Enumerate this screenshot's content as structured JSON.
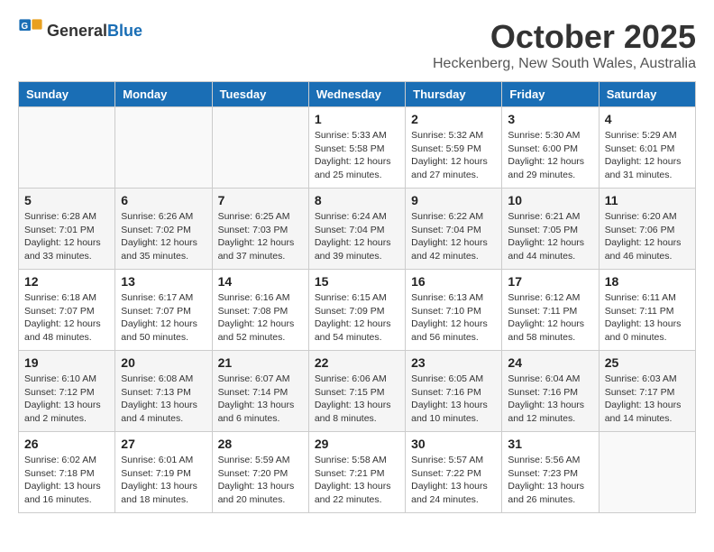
{
  "header": {
    "logo_general": "General",
    "logo_blue": "Blue",
    "title": "October 2025",
    "subtitle": "Heckenberg, New South Wales, Australia"
  },
  "weekdays": [
    "Sunday",
    "Monday",
    "Tuesday",
    "Wednesday",
    "Thursday",
    "Friday",
    "Saturday"
  ],
  "weeks": [
    [
      {
        "day": "",
        "sunrise": "",
        "sunset": "",
        "daylight": ""
      },
      {
        "day": "",
        "sunrise": "",
        "sunset": "",
        "daylight": ""
      },
      {
        "day": "",
        "sunrise": "",
        "sunset": "",
        "daylight": ""
      },
      {
        "day": "1",
        "sunrise": "Sunrise: 5:33 AM",
        "sunset": "Sunset: 5:58 PM",
        "daylight": "Daylight: 12 hours and 25 minutes."
      },
      {
        "day": "2",
        "sunrise": "Sunrise: 5:32 AM",
        "sunset": "Sunset: 5:59 PM",
        "daylight": "Daylight: 12 hours and 27 minutes."
      },
      {
        "day": "3",
        "sunrise": "Sunrise: 5:30 AM",
        "sunset": "Sunset: 6:00 PM",
        "daylight": "Daylight: 12 hours and 29 minutes."
      },
      {
        "day": "4",
        "sunrise": "Sunrise: 5:29 AM",
        "sunset": "Sunset: 6:01 PM",
        "daylight": "Daylight: 12 hours and 31 minutes."
      }
    ],
    [
      {
        "day": "5",
        "sunrise": "Sunrise: 6:28 AM",
        "sunset": "Sunset: 7:01 PM",
        "daylight": "Daylight: 12 hours and 33 minutes."
      },
      {
        "day": "6",
        "sunrise": "Sunrise: 6:26 AM",
        "sunset": "Sunset: 7:02 PM",
        "daylight": "Daylight: 12 hours and 35 minutes."
      },
      {
        "day": "7",
        "sunrise": "Sunrise: 6:25 AM",
        "sunset": "Sunset: 7:03 PM",
        "daylight": "Daylight: 12 hours and 37 minutes."
      },
      {
        "day": "8",
        "sunrise": "Sunrise: 6:24 AM",
        "sunset": "Sunset: 7:04 PM",
        "daylight": "Daylight: 12 hours and 39 minutes."
      },
      {
        "day": "9",
        "sunrise": "Sunrise: 6:22 AM",
        "sunset": "Sunset: 7:04 PM",
        "daylight": "Daylight: 12 hours and 42 minutes."
      },
      {
        "day": "10",
        "sunrise": "Sunrise: 6:21 AM",
        "sunset": "Sunset: 7:05 PM",
        "daylight": "Daylight: 12 hours and 44 minutes."
      },
      {
        "day": "11",
        "sunrise": "Sunrise: 6:20 AM",
        "sunset": "Sunset: 7:06 PM",
        "daylight": "Daylight: 12 hours and 46 minutes."
      }
    ],
    [
      {
        "day": "12",
        "sunrise": "Sunrise: 6:18 AM",
        "sunset": "Sunset: 7:07 PM",
        "daylight": "Daylight: 12 hours and 48 minutes."
      },
      {
        "day": "13",
        "sunrise": "Sunrise: 6:17 AM",
        "sunset": "Sunset: 7:07 PM",
        "daylight": "Daylight: 12 hours and 50 minutes."
      },
      {
        "day": "14",
        "sunrise": "Sunrise: 6:16 AM",
        "sunset": "Sunset: 7:08 PM",
        "daylight": "Daylight: 12 hours and 52 minutes."
      },
      {
        "day": "15",
        "sunrise": "Sunrise: 6:15 AM",
        "sunset": "Sunset: 7:09 PM",
        "daylight": "Daylight: 12 hours and 54 minutes."
      },
      {
        "day": "16",
        "sunrise": "Sunrise: 6:13 AM",
        "sunset": "Sunset: 7:10 PM",
        "daylight": "Daylight: 12 hours and 56 minutes."
      },
      {
        "day": "17",
        "sunrise": "Sunrise: 6:12 AM",
        "sunset": "Sunset: 7:11 PM",
        "daylight": "Daylight: 12 hours and 58 minutes."
      },
      {
        "day": "18",
        "sunrise": "Sunrise: 6:11 AM",
        "sunset": "Sunset: 7:11 PM",
        "daylight": "Daylight: 13 hours and 0 minutes."
      }
    ],
    [
      {
        "day": "19",
        "sunrise": "Sunrise: 6:10 AM",
        "sunset": "Sunset: 7:12 PM",
        "daylight": "Daylight: 13 hours and 2 minutes."
      },
      {
        "day": "20",
        "sunrise": "Sunrise: 6:08 AM",
        "sunset": "Sunset: 7:13 PM",
        "daylight": "Daylight: 13 hours and 4 minutes."
      },
      {
        "day": "21",
        "sunrise": "Sunrise: 6:07 AM",
        "sunset": "Sunset: 7:14 PM",
        "daylight": "Daylight: 13 hours and 6 minutes."
      },
      {
        "day": "22",
        "sunrise": "Sunrise: 6:06 AM",
        "sunset": "Sunset: 7:15 PM",
        "daylight": "Daylight: 13 hours and 8 minutes."
      },
      {
        "day": "23",
        "sunrise": "Sunrise: 6:05 AM",
        "sunset": "Sunset: 7:16 PM",
        "daylight": "Daylight: 13 hours and 10 minutes."
      },
      {
        "day": "24",
        "sunrise": "Sunrise: 6:04 AM",
        "sunset": "Sunset: 7:16 PM",
        "daylight": "Daylight: 13 hours and 12 minutes."
      },
      {
        "day": "25",
        "sunrise": "Sunrise: 6:03 AM",
        "sunset": "Sunset: 7:17 PM",
        "daylight": "Daylight: 13 hours and 14 minutes."
      }
    ],
    [
      {
        "day": "26",
        "sunrise": "Sunrise: 6:02 AM",
        "sunset": "Sunset: 7:18 PM",
        "daylight": "Daylight: 13 hours and 16 minutes."
      },
      {
        "day": "27",
        "sunrise": "Sunrise: 6:01 AM",
        "sunset": "Sunset: 7:19 PM",
        "daylight": "Daylight: 13 hours and 18 minutes."
      },
      {
        "day": "28",
        "sunrise": "Sunrise: 5:59 AM",
        "sunset": "Sunset: 7:20 PM",
        "daylight": "Daylight: 13 hours and 20 minutes."
      },
      {
        "day": "29",
        "sunrise": "Sunrise: 5:58 AM",
        "sunset": "Sunset: 7:21 PM",
        "daylight": "Daylight: 13 hours and 22 minutes."
      },
      {
        "day": "30",
        "sunrise": "Sunrise: 5:57 AM",
        "sunset": "Sunset: 7:22 PM",
        "daylight": "Daylight: 13 hours and 24 minutes."
      },
      {
        "day": "31",
        "sunrise": "Sunrise: 5:56 AM",
        "sunset": "Sunset: 7:23 PM",
        "daylight": "Daylight: 13 hours and 26 minutes."
      },
      {
        "day": "",
        "sunrise": "",
        "sunset": "",
        "daylight": ""
      }
    ]
  ]
}
